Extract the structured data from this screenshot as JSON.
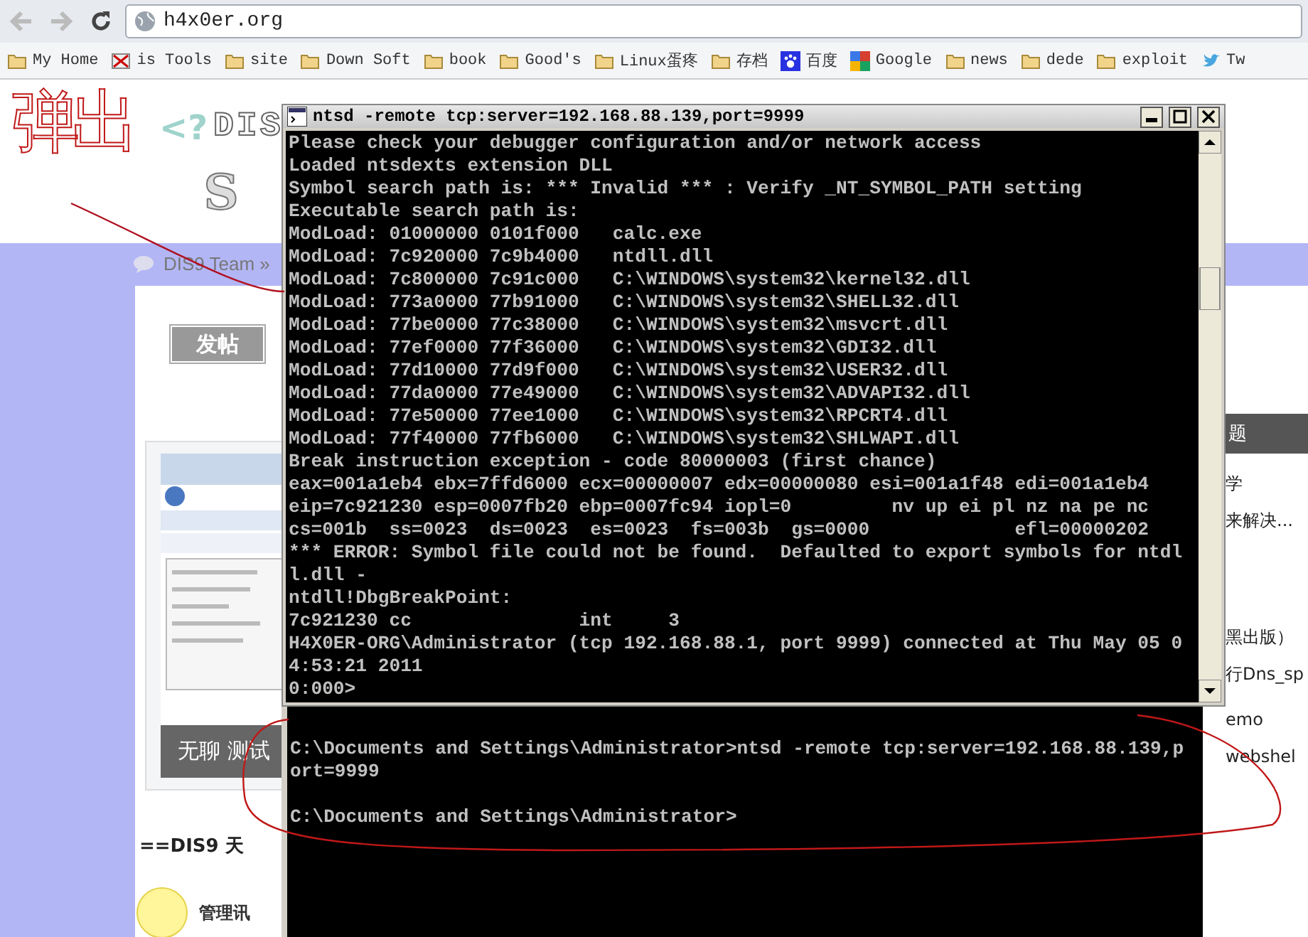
{
  "browser": {
    "address": "h4x0er.org",
    "bookmarks": [
      {
        "label": "My Home",
        "kind": "folder"
      },
      {
        "label": "is Tools",
        "kind": "broken"
      },
      {
        "label": "site",
        "kind": "folder"
      },
      {
        "label": "Down Soft",
        "kind": "folder"
      },
      {
        "label": "book",
        "kind": "folder"
      },
      {
        "label": "Good's",
        "kind": "folder"
      },
      {
        "label": "Linux蛋疼",
        "kind": "folder"
      },
      {
        "label": "存档",
        "kind": "folder"
      },
      {
        "label": "百度",
        "kind": "paw"
      },
      {
        "label": "Google",
        "kind": "google"
      },
      {
        "label": "news",
        "kind": "folder"
      },
      {
        "label": "dede",
        "kind": "folder"
      },
      {
        "label": "exploit",
        "kind": "folder"
      },
      {
        "label": "Tw",
        "kind": "bird"
      }
    ]
  },
  "web_page": {
    "logo": {
      "mark": "<?",
      "name": "DIS",
      "tagline": "S"
    },
    "breadcrumb": "DIS9 Team »",
    "post_button": "发帖",
    "thumbnail": {
      "kind": "picture",
      "caption": "无聊 测试"
    },
    "section_title": "==DIS9 天",
    "poster": "管理讯",
    "side_header": "题",
    "side_items": [
      {
        "text": "学"
      },
      {
        "text": "来解决..."
      },
      {
        "text": "黑出版）"
      },
      {
        "text": "行Dns_sp"
      },
      {
        "text": "emo"
      },
      {
        "text": "webshel"
      }
    ]
  },
  "console_window": {
    "title": "ntsd -remote tcp:server=192.168.88.139,port=9999",
    "lines": [
      "Please check your debugger configuration and/or network access",
      "Loaded ntsdexts extension DLL",
      "Symbol search path is: *** Invalid *** : Verify _NT_SYMBOL_PATH setting",
      "Executable search path is:",
      "ModLoad: 01000000 0101f000   calc.exe",
      "ModLoad: 7c920000 7c9b4000   ntdll.dll",
      "ModLoad: 7c800000 7c91c000   C:\\WINDOWS\\system32\\kernel32.dll",
      "ModLoad: 773a0000 77b91000   C:\\WINDOWS\\system32\\SHELL32.dll",
      "ModLoad: 77be0000 77c38000   C:\\WINDOWS\\system32\\msvcrt.dll",
      "ModLoad: 77ef0000 77f36000   C:\\WINDOWS\\system32\\GDI32.dll",
      "ModLoad: 77d10000 77d9f000   C:\\WINDOWS\\system32\\USER32.dll",
      "ModLoad: 77da0000 77e49000   C:\\WINDOWS\\system32\\ADVAPI32.dll",
      "ModLoad: 77e50000 77ee1000   C:\\WINDOWS\\system32\\RPCRT4.dll",
      "ModLoad: 77f40000 77fb6000   C:\\WINDOWS\\system32\\SHLWAPI.dll",
      "Break instruction exception - code 80000003 (first chance)",
      "eax=001a1eb4 ebx=7ffd6000 ecx=00000007 edx=00000080 esi=001a1f48 edi=001a1eb4",
      "eip=7c921230 esp=0007fb20 ebp=0007fc94 iopl=0         nv up ei pl nz na pe nc",
      "cs=001b  ss=0023  ds=0023  es=0023  fs=003b  gs=0000             efl=00000202",
      "*** ERROR: Symbol file could not be found.  Defaulted to export symbols for ntdl",
      "l.dll -",
      "ntdll!DbgBreakPoint:",
      "7c921230 cc               int     3",
      "H4X0ER-ORG\\Administrator (tcp 192.168.88.1, port 9999) connected at Thu May 05 0",
      "4:53:21 2011",
      "0:000>"
    ]
  },
  "command_window": {
    "lines": [
      "C:\\Documents and Settings\\Administrator>ntsd -remote tcp:server=192.168.88.139,p",
      "ort=9999"
    ],
    "prompt": "C:\\Documents and Settings\\Administrator>"
  },
  "annotation": {
    "text": "弹出"
  }
}
